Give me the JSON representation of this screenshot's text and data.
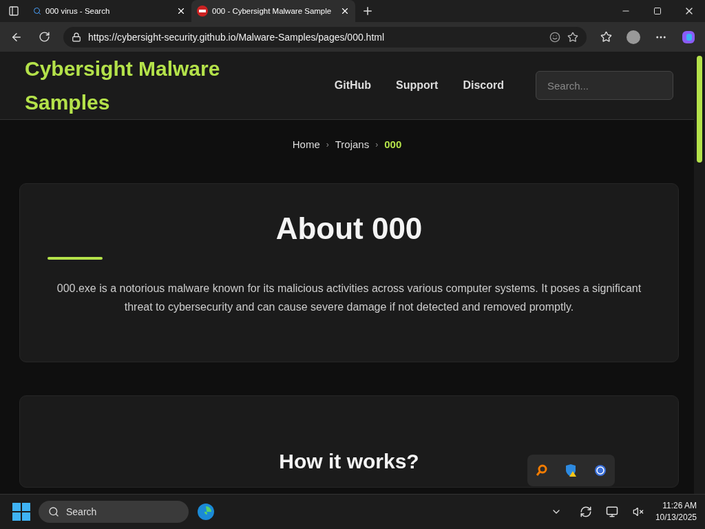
{
  "browser": {
    "tabs": [
      {
        "title": "000 virus - Search",
        "selected": false
      },
      {
        "title": "000 - Cybersight Malware Sample",
        "selected": true
      }
    ],
    "url": "https://cybersight-security.github.io/Malware-Samples/pages/000.html"
  },
  "site": {
    "title": "Cybersight Malware Samples",
    "nav": [
      "GitHub",
      "Support",
      "Discord"
    ],
    "search": {
      "placeholder": "Search..."
    }
  },
  "breadcrumb": [
    {
      "label": "Home",
      "selected": false
    },
    {
      "label": "Trojans",
      "selected": false
    },
    {
      "label": "000",
      "selected": true
    }
  ],
  "breadcrumb_separator": "›",
  "about": {
    "title": "About 000",
    "text": "000.exe is a notorious malware known for its malicious activities across various computer systems. It poses a significant threat to cybersecurity and can cause severe damage if not detected and removed promptly."
  },
  "how": {
    "title": "How it works?"
  },
  "taskbar": {
    "search": "Search",
    "time": "11:26 AM",
    "date": "10/13/2025"
  }
}
